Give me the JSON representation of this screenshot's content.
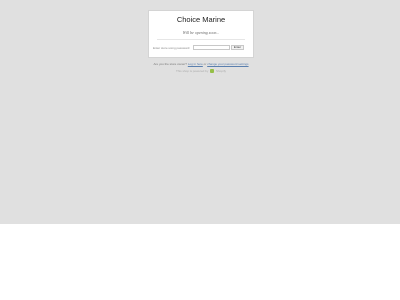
{
  "store": {
    "name": "Choice Marine",
    "message": "Will be opening soon..."
  },
  "password_form": {
    "label": "Enter store using password:",
    "input_value": "",
    "button_label": "Enter"
  },
  "footer": {
    "owner_prefix": "Are you the store owner?",
    "login_link": "Log in here",
    "or_text": "or",
    "change_link": "change your password settings",
    "powered_prefix": "This shop is powered by",
    "powered_brand": "Shopify"
  },
  "colors": {
    "background": "#e0e0e0",
    "card": "#ffffff",
    "link": "#5a7fae",
    "brand_icon": "#95bf47"
  },
  "icons": {
    "brand": "shopify-bag-icon"
  }
}
